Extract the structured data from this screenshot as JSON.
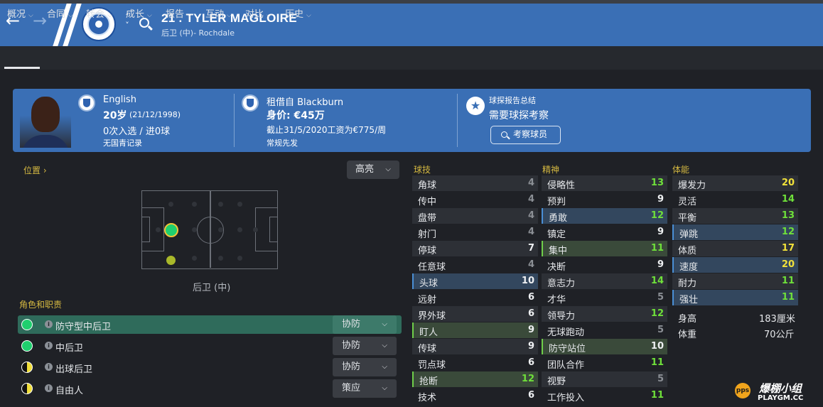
{
  "header": {
    "title": "21 . TYLER MAGLOIRE",
    "subtitle": "后卫 (中)- Rochdale"
  },
  "menu": [
    "概况",
    "合同",
    "转会",
    "成长",
    "报告",
    "互动",
    "对比",
    "历史"
  ],
  "summary": {
    "nationality": "English",
    "age": "20岁",
    "birth": "(21/12/1998)",
    "caps": "0次入选 / 进0球",
    "youth": "无国青记录",
    "loan": "租借自 Blackburn",
    "value": "身价: €45万",
    "contract": "截止31/5/2020工资为€775/周",
    "status": "常规先发",
    "scout_title": "球探报告总结",
    "scout_need": "需要球探考察",
    "scout_button": "考察球员"
  },
  "position": {
    "label": "位置",
    "highlight": "高亮",
    "name": "后卫 (中)"
  },
  "roles": {
    "header": "角色和职责",
    "items": [
      {
        "name": "防守型中后卫",
        "duty": "协防"
      },
      {
        "name": "中后卫",
        "duty": "协防"
      },
      {
        "name": "出球后卫",
        "duty": "协防"
      },
      {
        "name": "自由人",
        "duty": "策应"
      }
    ]
  },
  "attributes": {
    "technical": {
      "title": "球技",
      "items": [
        {
          "name": "角球",
          "value": "4"
        },
        {
          "name": "传中",
          "value": "4"
        },
        {
          "name": "盘带",
          "value": "4"
        },
        {
          "name": "射门",
          "value": "4"
        },
        {
          "name": "停球",
          "value": "7"
        },
        {
          "name": "任意球",
          "value": "4"
        },
        {
          "name": "头球",
          "value": "10"
        },
        {
          "name": "远射",
          "value": "6"
        },
        {
          "name": "界外球",
          "value": "6"
        },
        {
          "name": "盯人",
          "value": "9"
        },
        {
          "name": "传球",
          "value": "9"
        },
        {
          "name": "罚点球",
          "value": "6"
        },
        {
          "name": "抢断",
          "value": "12"
        },
        {
          "name": "技术",
          "value": "6"
        }
      ]
    },
    "mental": {
      "title": "精神",
      "items": [
        {
          "name": "侵略性",
          "value": "13"
        },
        {
          "name": "预判",
          "value": "9"
        },
        {
          "name": "勇敢",
          "value": "12"
        },
        {
          "name": "镇定",
          "value": "9"
        },
        {
          "name": "集中",
          "value": "11"
        },
        {
          "name": "决断",
          "value": "9"
        },
        {
          "name": "意志力",
          "value": "14"
        },
        {
          "name": "才华",
          "value": "5"
        },
        {
          "name": "领导力",
          "value": "12"
        },
        {
          "name": "无球跑动",
          "value": "5"
        },
        {
          "name": "防守站位",
          "value": "10"
        },
        {
          "name": "团队合作",
          "value": "11"
        },
        {
          "name": "视野",
          "value": "5"
        },
        {
          "name": "工作投入",
          "value": "11"
        }
      ]
    },
    "physical": {
      "title": "体能",
      "items": [
        {
          "name": "爆发力",
          "value": "20"
        },
        {
          "name": "灵活",
          "value": "14"
        },
        {
          "name": "平衡",
          "value": "13"
        },
        {
          "name": "弹跳",
          "value": "12"
        },
        {
          "name": "体质",
          "value": "17"
        },
        {
          "name": "速度",
          "value": "20"
        },
        {
          "name": "耐力",
          "value": "11"
        },
        {
          "name": "强壮",
          "value": "11"
        }
      ],
      "height_label": "身高",
      "height": "183厘米",
      "weight_label": "体重",
      "weight": "70公斤"
    }
  },
  "watermark": {
    "title": "爆棚小组",
    "url": "PLAYGM.CC"
  }
}
